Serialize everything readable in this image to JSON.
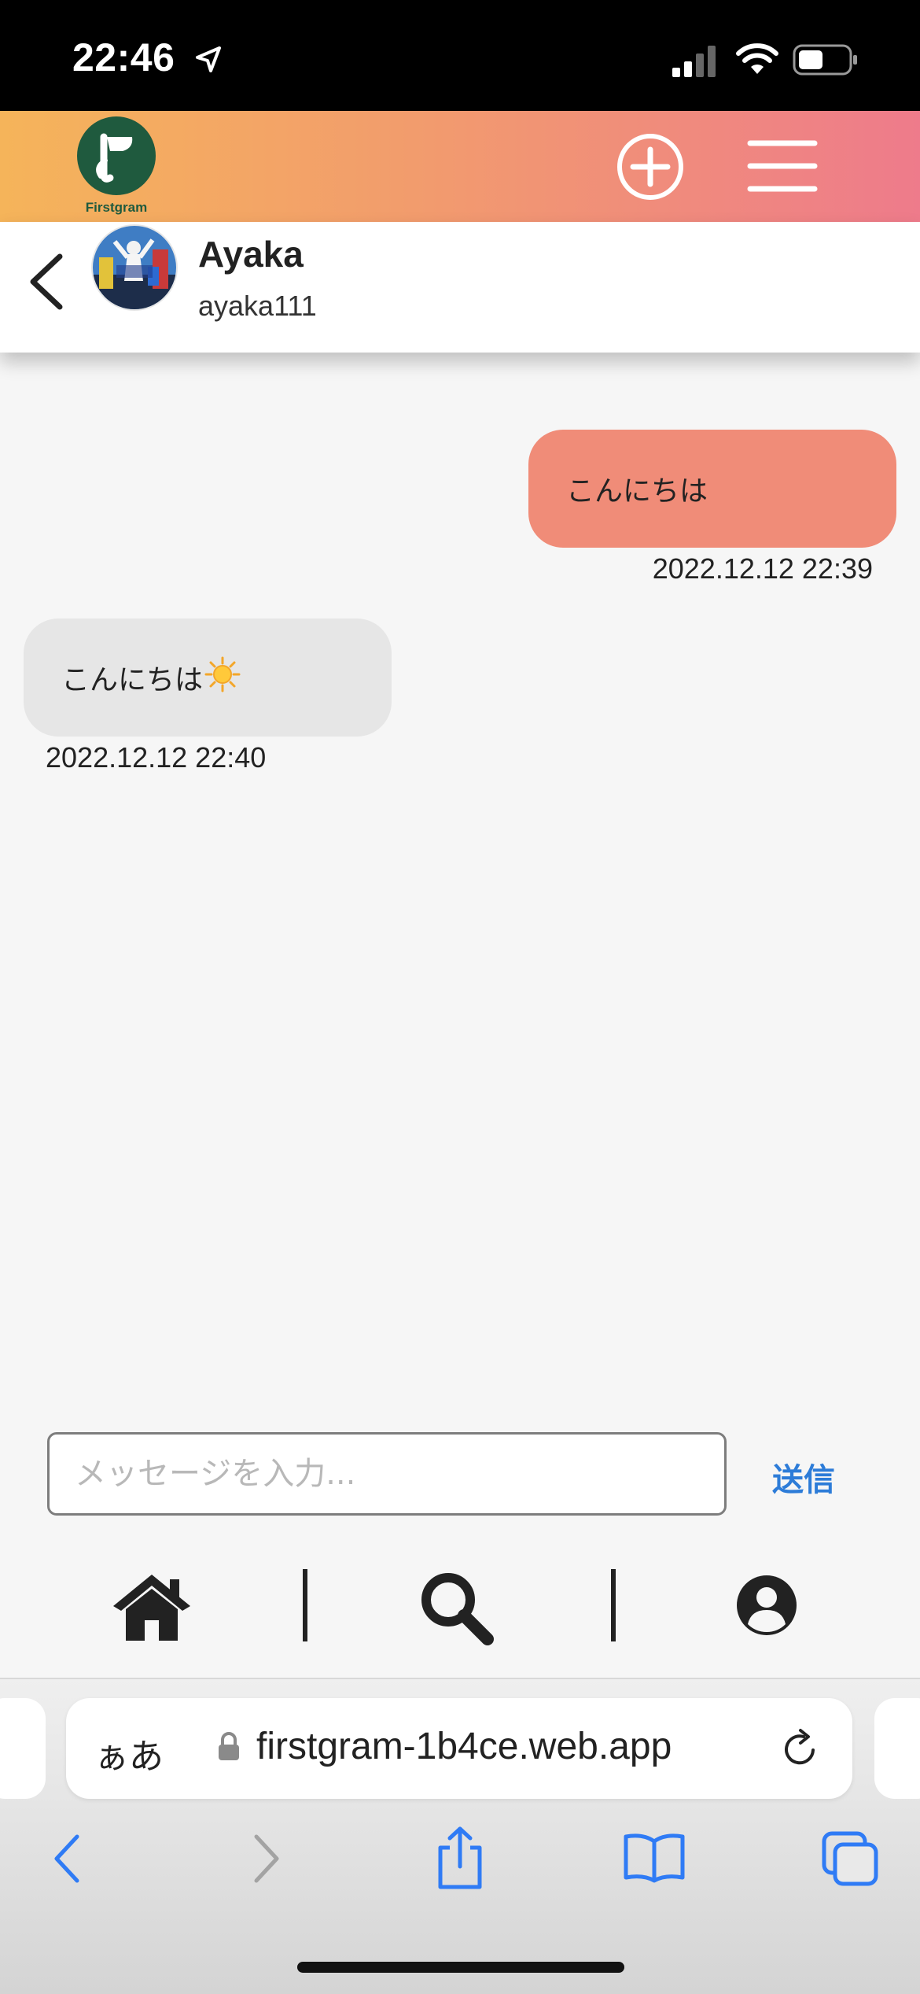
{
  "status_bar": {
    "time": "22:46"
  },
  "app_header": {
    "logo_text": "Firstgram",
    "gradient_colors": [
      "#f5b45a",
      "#ee7b8b"
    ]
  },
  "chat_header": {
    "name": "Ayaka",
    "handle": "ayaka111"
  },
  "messages": [
    {
      "direction": "sent",
      "text": "こんにちは",
      "timestamp": "2022.12.12 22:39",
      "bubble_color": "#f08c78"
    },
    {
      "direction": "received",
      "text": "こんにちは",
      "emoji": "sun-icon",
      "timestamp": "2022.12.12 22:40",
      "bubble_color": "#e6e6e6"
    }
  ],
  "composer": {
    "placeholder": "メッセージを入力...",
    "value": "",
    "send_label": "送信",
    "send_color": "#2d7cd8"
  },
  "bottom_nav": {
    "items": [
      "home-icon",
      "search-icon",
      "profile-icon"
    ]
  },
  "browser": {
    "aa_label": "ぁあ",
    "url": "firstgram-1b4ce.web.app",
    "accent": "#2f7bf5"
  }
}
